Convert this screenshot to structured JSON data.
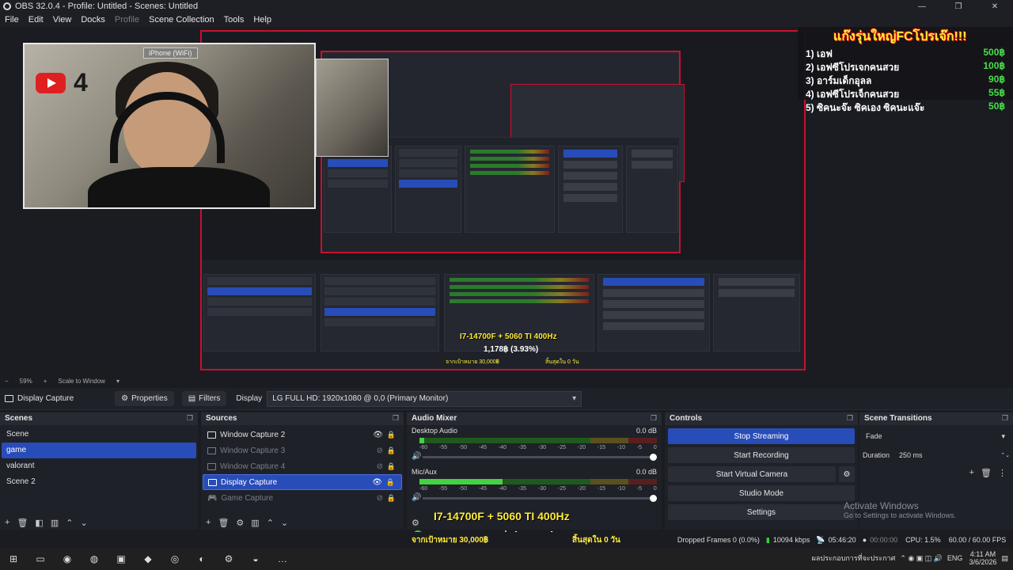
{
  "window": {
    "title": "OBS 32.0.4 - Profile: Untitled - Scenes: Untitled",
    "controls": [
      "—",
      "❐",
      "✕"
    ]
  },
  "menu": [
    "File",
    "Edit",
    "View",
    "Docks",
    "Profile",
    "Scene Collection",
    "Tools",
    "Help"
  ],
  "webcam": {
    "tag": "iPhone (WiFi)",
    "yt_number": "4"
  },
  "leaderboard": {
    "title": "แก๊งรุ่นใหญ่FCโปรเจ๊ก!!!",
    "rows": [
      {
        "name": "1) เอฟ",
        "value": "500฿"
      },
      {
        "name": "2) เอฟซีโปรเจกคนสวย",
        "value": "100฿"
      },
      {
        "name": "3) อาร์มเด็กอุลล",
        "value": "90฿"
      },
      {
        "name": "4) เอฟซีโปรเจ็กคนสวย",
        "value": "55฿"
      },
      {
        "name": "5) ซิคนะจ๊ะ ซิคเอง ซิคนะแจ๊ะ",
        "value": "50฿"
      }
    ]
  },
  "nested_overlay": {
    "cpu": "I7-14700F + 5060 TI 400Hz",
    "pct": "1,178฿ (3.93%)",
    "target": "จากเป้าหมาย 30,000฿",
    "days": "สิ้นสุดใน 0 วัน"
  },
  "zoom": {
    "pct": "59%",
    "mode": "Scale to Window"
  },
  "props_bar": {
    "source": "Display Capture",
    "properties": "Properties",
    "filters": "Filters",
    "display_label": "Display",
    "display_value": "LG FULL HD: 1920x1080 @ 0,0 (Primary Monitor)"
  },
  "scenes": {
    "title": "Scenes",
    "items": [
      "Scene",
      "game",
      "valorant",
      "Scene 2"
    ],
    "selected": 1
  },
  "sources": {
    "title": "Sources",
    "items": [
      {
        "name": "Window Capture 2",
        "dim": false,
        "sel": false,
        "visible": true
      },
      {
        "name": "Window Capture 3",
        "dim": true,
        "sel": false,
        "visible": false
      },
      {
        "name": "Window Capture 4",
        "dim": true,
        "sel": false,
        "visible": false
      },
      {
        "name": "Display Capture",
        "dim": false,
        "sel": true,
        "visible": true
      },
      {
        "name": "Game Capture",
        "dim": true,
        "sel": false,
        "visible": false
      }
    ]
  },
  "mixer": {
    "title": "Audio Mixer",
    "channels": [
      {
        "name": "Desktop Audio",
        "db": "0.0 dB",
        "level": 0.02
      },
      {
        "name": "Mic/Aux",
        "db": "0.0 dB",
        "level": 0.35
      }
    ],
    "ticks": [
      "-60",
      "-55",
      "-50",
      "-45",
      "-40",
      "-35",
      "-30",
      "-25",
      "-20",
      "-15",
      "-10",
      "-5",
      "0"
    ]
  },
  "controls": {
    "title": "Controls",
    "stop_streaming": "Stop Streaming",
    "start_recording": "Start Recording",
    "start_virtual_camera": "Start Virtual Camera",
    "studio_mode": "Studio Mode",
    "settings": "Settings"
  },
  "transitions": {
    "title": "Scene Transitions",
    "type": "Fade",
    "duration_label": "Duration",
    "duration_value": "250 ms"
  },
  "overlay": {
    "cpu": "I7-14700F + 5060 TI 400Hz",
    "pct": "1,178฿ (3.93%)",
    "target": "จากเป้าหมาย 30,000฿",
    "days": "สิ้นสุดใน 0 วัน"
  },
  "activate": {
    "title": "Activate Windows",
    "sub": "Go to Settings to activate Windows."
  },
  "status": {
    "dropped": "Dropped Frames 0 (0.0%)",
    "kbps": "10094 kbps",
    "stream_time": "05:46:20",
    "rec_time": "00:00:00",
    "cpu": "CPU: 1.5%",
    "fps": "60.00 / 60.00 FPS"
  },
  "taskbar": {
    "news": "ผลประกอบการที่จะประกาศ",
    "lang": "ENG",
    "time": "4:11 AM",
    "date": "3/6/2026"
  },
  "colors": {
    "accent": "#284cb8",
    "record_red": "#c8102e",
    "meter_green": "#44d244"
  }
}
